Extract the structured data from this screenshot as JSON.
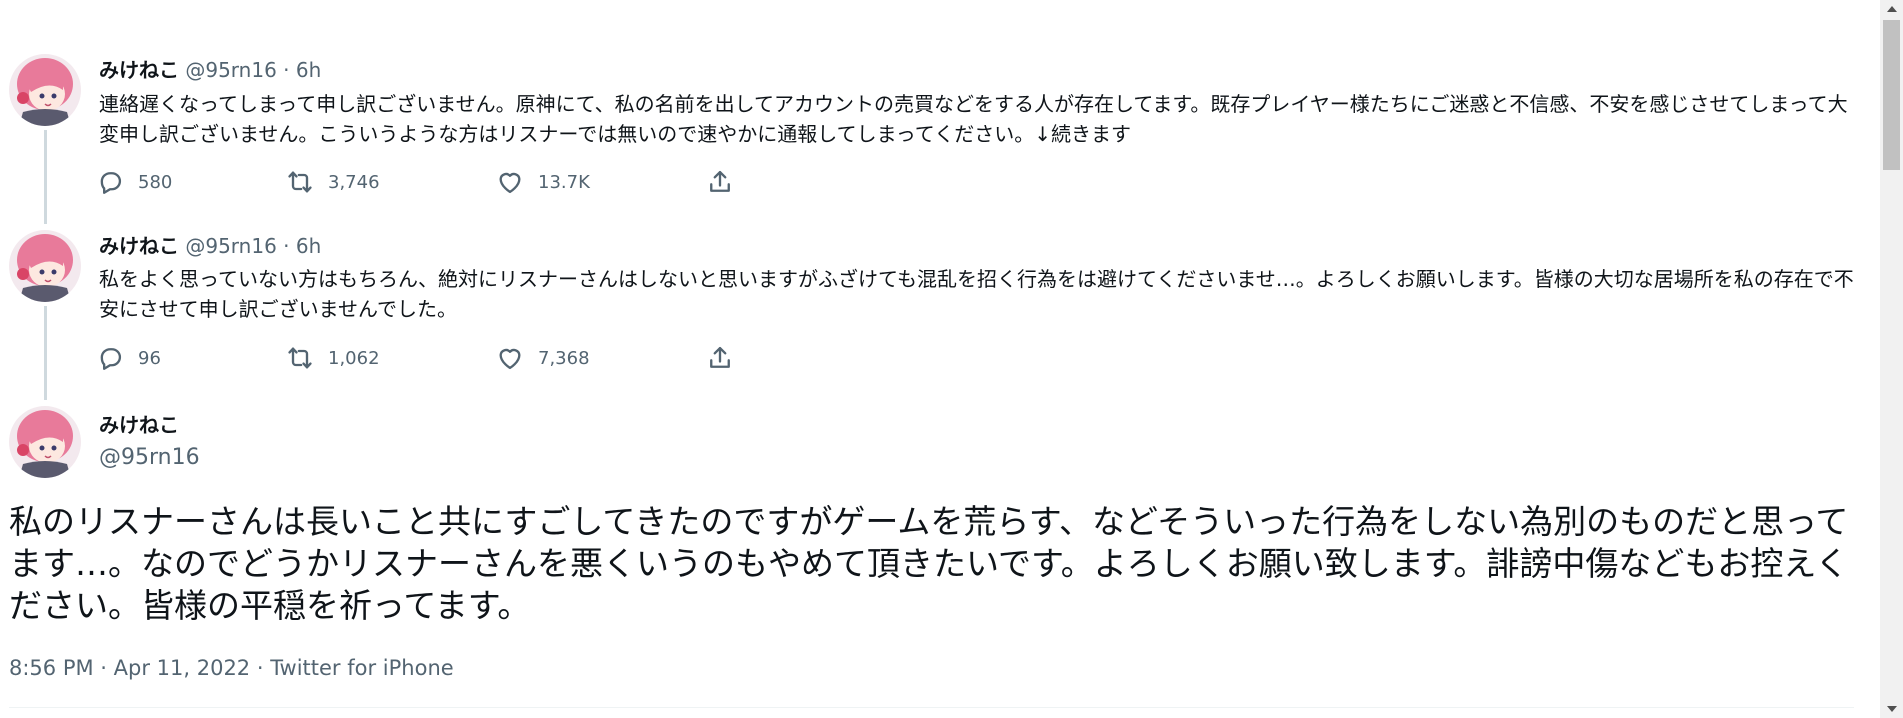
{
  "thread": [
    {
      "display_name": "みけねこ",
      "handle": "@95rn16",
      "separator": "·",
      "time": "6h",
      "text": "連絡遅くなってしまって申し訳ございません。原神にて、私の名前を出してアカウントの売買などをする人が存在してます。既存プレイヤー様たちにご迷惑と不信感、不安を感じさせてしまって大変申し訳ございません。こういうような方はリスナーでは無いので速やかに通報してしまってください。↓続きます",
      "replies": "580",
      "retweets": "3,746",
      "likes": "13.7K"
    },
    {
      "display_name": "みけねこ",
      "handle": "@95rn16",
      "separator": "·",
      "time": "6h",
      "text": "私をよく思っていない方はもちろん、絶対にリスナーさんはしないと思いますがふざけても混乱を招く行為をは避けてくださいませ…。よろしくお願いします。皆様の大切な居場所を私の存在で不安にさせて申し訳ございませんでした。",
      "replies": "96",
      "retweets": "1,062",
      "likes": "7,368"
    }
  ],
  "focused": {
    "display_name": "みけねこ",
    "handle": "@95rn16",
    "text": "私のリスナーさんは長いこと共にすごしてきたのですがゲームを荒らす、などそういった行為をしない為別のものだと思ってます…。なのでどうかリスナーさんを悪くいうのもやめて頂きたいです。よろしくお願い致します。誹謗中傷などもお控えください。皆様の平穏を祈ってます。",
    "timestamp": "8:56 PM · Apr 11, 2022 · Twitter for iPhone"
  },
  "icons": {
    "reply": "reply-icon",
    "retweet": "retweet-icon",
    "like": "heart-icon",
    "share": "share-icon"
  },
  "colors": {
    "text": "#0f1419",
    "secondary": "#536471",
    "thread_line": "#cfd9de",
    "avatar_hair": "#e87a9a"
  }
}
